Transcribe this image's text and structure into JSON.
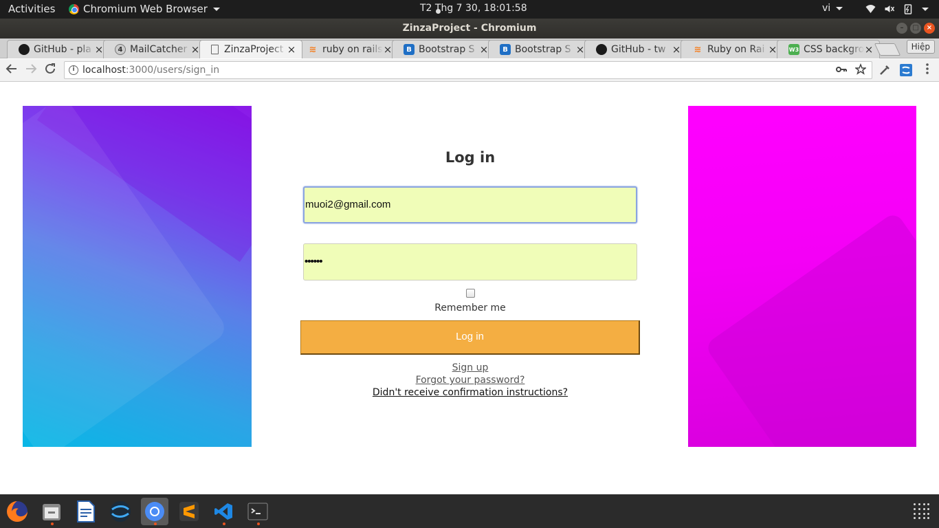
{
  "topbar": {
    "activities": "Activities",
    "app_name": "Chromium Web Browser",
    "clock": "T2 Thg 7 30, 18:01:58",
    "lang": "vi"
  },
  "window": {
    "title": "ZinzaProject - Chromium"
  },
  "tabs": [
    {
      "label": "GitHub - pla",
      "icon": "github-icon"
    },
    {
      "label": "MailCatcher",
      "icon": "mailcatcher-icon"
    },
    {
      "label": "ZinzaProject",
      "icon": "document-icon",
      "active": true
    },
    {
      "label": "ruby on rails",
      "icon": "stackoverflow-icon"
    },
    {
      "label": "Bootstrap S",
      "icon": "bootstrap-icon"
    },
    {
      "label": "Bootstrap S",
      "icon": "bootstrap-icon"
    },
    {
      "label": "GitHub - tw",
      "icon": "github-icon"
    },
    {
      "label": "Ruby on Rai",
      "icon": "stackoverflow-icon"
    },
    {
      "label": "CSS backgro",
      "icon": "css-icon"
    }
  ],
  "profile": "Hiệp",
  "address": {
    "host": "localhost",
    "path": ":3000/users/sign_in"
  },
  "form": {
    "title": "Log in",
    "email_value": "muoi2@gmail.com",
    "password_value": "••••••",
    "remember_label": "Remember me",
    "remember_checked": false,
    "submit_label": "Log in",
    "links": [
      "Sign up",
      "Forgot your password?",
      "Didn't receive confirmation instructions?"
    ]
  },
  "colors": {
    "submit_bg": "#f4ae42",
    "input_bg": "#f0fdb8",
    "left_panel_top": "#8b18e8",
    "left_panel_bottom": "#08b7e6",
    "right_panel": "#ff00ff",
    "accent": "#e95420"
  },
  "dock": [
    "firefox-icon",
    "files-icon",
    "writer-icon",
    "app-icon",
    "chromium-icon",
    "sublime-icon",
    "vscode-icon",
    "terminal-icon"
  ]
}
